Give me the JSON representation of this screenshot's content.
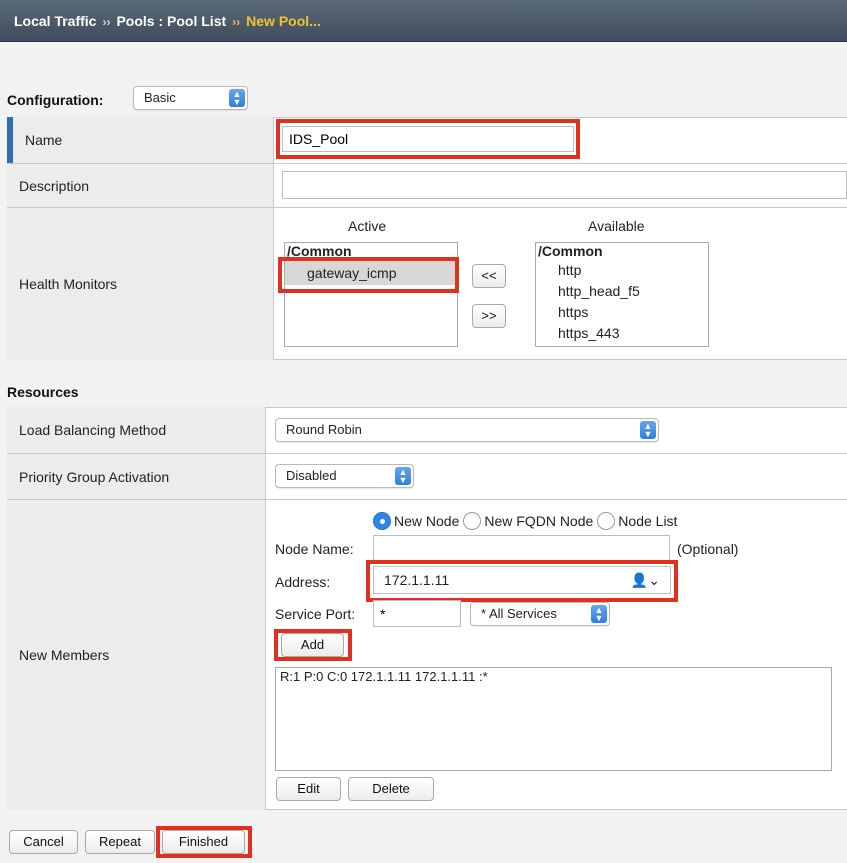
{
  "breadcrumb": {
    "part1": "Local Traffic",
    "part2": "Pools : Pool List",
    "current": "New Pool...",
    "sep": "››"
  },
  "configuration": {
    "label": "Configuration:",
    "mode": "Basic"
  },
  "general": {
    "name_label": "Name",
    "name_value": "IDS_Pool",
    "description_label": "Description",
    "description_value": "",
    "health_monitors_label": "Health Monitors",
    "active_header": "Active",
    "available_header": "Available",
    "active_group": "/Common",
    "active_items": [
      "gateway_icmp"
    ],
    "available_group": "/Common",
    "available_items": [
      "http",
      "http_head_f5",
      "https",
      "https_443"
    ],
    "move_left": "<<",
    "move_right": ">>"
  },
  "resources": {
    "title": "Resources",
    "lb_method_label": "Load Balancing Method",
    "lb_method_value": "Round Robin",
    "priority_label": "Priority Group Activation",
    "priority_value": "Disabled",
    "new_members_label": "New Members",
    "radio_new_node": "New Node",
    "radio_fqdn": "New FQDN Node",
    "radio_node_list": "Node List",
    "node_name_label": "Node Name:",
    "node_name_value": "",
    "optional_text": "(Optional)",
    "address_label": "Address:",
    "address_value": "172.1.1.11",
    "service_port_label": "Service Port:",
    "service_port_value": "*",
    "service_select": "* All Services",
    "add_button": "Add",
    "members": [
      "R:1 P:0 C:0 172.1.1.11 172.1.1.11 :*"
    ],
    "edit_button": "Edit",
    "delete_button": "Delete"
  },
  "footer": {
    "cancel": "Cancel",
    "repeat": "Repeat",
    "finished": "Finished"
  },
  "colors": {
    "highlight": "#e0301e",
    "accent_blue": "#2f86e8",
    "breadcrumb_current": "#f2c230"
  }
}
